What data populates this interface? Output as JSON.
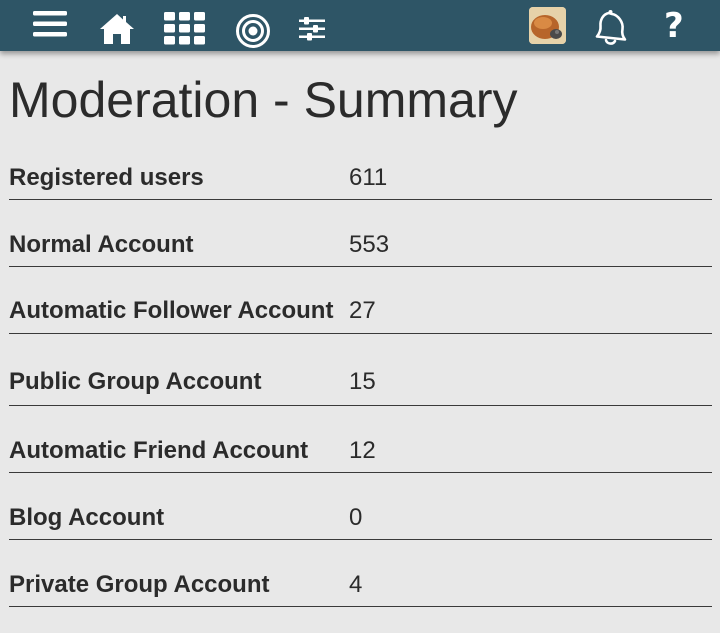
{
  "page": {
    "title": "Moderation - Summary"
  },
  "nav": {
    "icons": [
      "menu-icon",
      "home-icon",
      "grid-icon",
      "target-icon",
      "sliders-icon",
      "avatar",
      "bell-icon",
      "help-icon"
    ],
    "help_glyph": "?"
  },
  "colors": {
    "topbar": "#2e5566",
    "background": "#e8e8e8",
    "text": "#2b2b2b",
    "icon": "#ffffff"
  },
  "stats": [
    {
      "label": "Registered users",
      "value": "611"
    },
    {
      "label": "Normal Account",
      "value": "553"
    },
    {
      "label": "Automatic Follower Account",
      "value": "27"
    },
    {
      "label": "Public Group Account",
      "value": "15"
    },
    {
      "label": "Automatic Friend Account",
      "value": "12"
    },
    {
      "label": "Blog Account",
      "value": "0"
    },
    {
      "label": "Private Group Account",
      "value": "4"
    }
  ]
}
